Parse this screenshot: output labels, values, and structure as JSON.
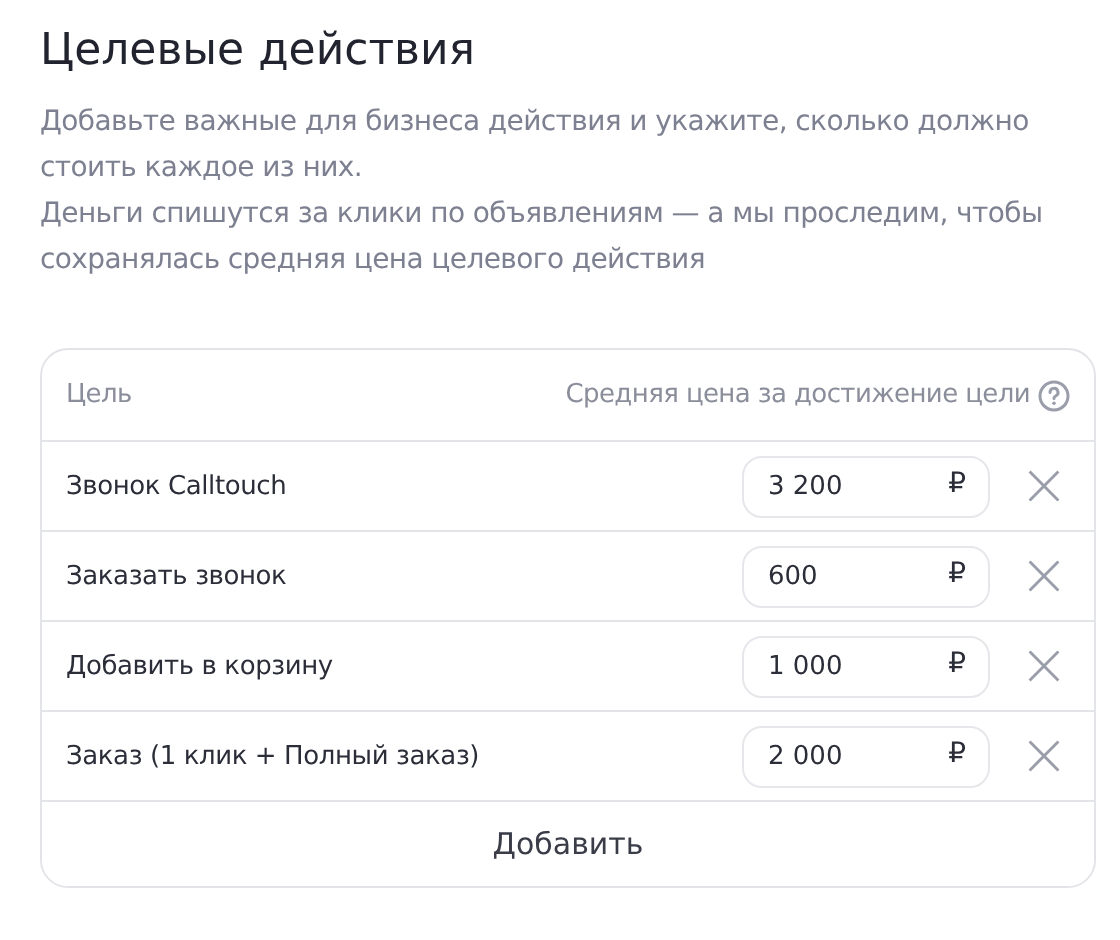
{
  "title": "Целевые действия",
  "description": [
    "Добавьте важные для бизнеса действия и укажите, сколько должно стоить каждое из них.",
    "Деньги спишутся за клики по объявлениям — а мы проследим, чтобы сохранялась средняя цена целевого действия"
  ],
  "table": {
    "columns": [
      "Цель",
      "Средняя цена за достижение цели"
    ],
    "rows": [
      {
        "goal": "Звонок Calltouch",
        "price": "3 200",
        "currency": "₽"
      },
      {
        "goal": "Заказать звонок",
        "price": "600",
        "currency": "₽"
      },
      {
        "goal": "Добавить в корзину",
        "price": "1 000",
        "currency": "₽"
      },
      {
        "goal": "Заказ (1 клик + Полный заказ)",
        "price": "2 000",
        "currency": "₽"
      }
    ],
    "add_button": "Добавить"
  }
}
